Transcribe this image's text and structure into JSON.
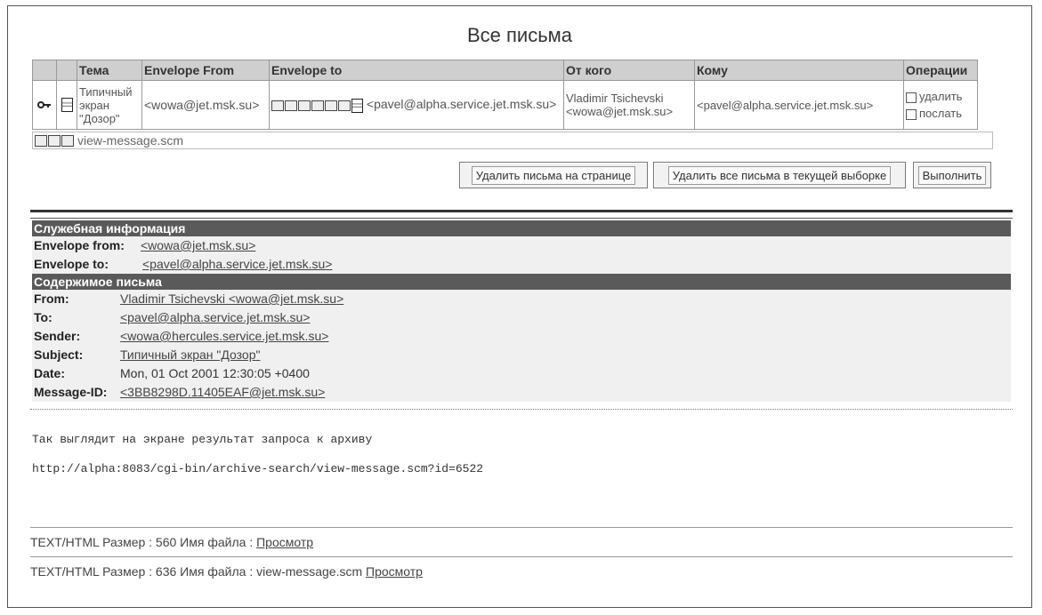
{
  "page": {
    "title": "Все письма"
  },
  "table": {
    "headers": [
      "Тема",
      "Envelope From",
      "Envelope to",
      "От кого",
      "Кому",
      "Операции"
    ],
    "row": {
      "subject_line1": "Типичный",
      "subject_line2": "экран",
      "subject_line3": "\"Дозор\"",
      "envelope_from": "<wowa@jet.msk.su>",
      "envelope_to": "<pavel@alpha.service.jet.msk.su>",
      "from_name": "Vladimir Tsichevski",
      "from_email": "<wowa@jet.msk.su>",
      "to": "<pavel@alpha.service.jet.msk.su>",
      "op_delete": "удалить",
      "op_send": "послать"
    }
  },
  "attachments_row": {
    "filename": "view-message.scm"
  },
  "buttons": {
    "delete_page": "Удалить письма на странице",
    "delete_all": "Удалить все письма в текущей выборке",
    "execute": "Выполнить"
  },
  "service_info": {
    "heading": "Служебная информация",
    "envelope_from_label": "Envelope from:",
    "envelope_from_value": "<wowa@jet.msk.su>",
    "envelope_to_label": "Envelope to:",
    "envelope_to_value": "<pavel@alpha.service.jet.msk.su>"
  },
  "content": {
    "heading": "Содержимое письма",
    "from_label": "From:",
    "from_value": "Vladimir Tsichevski <wowa@jet.msk.su>",
    "to_label": "To:",
    "to_value": "<pavel@alpha.service.jet.msk.su>",
    "sender_label": "Sender:",
    "sender_value": "<wowa@hercules.service.jet.msk.su>",
    "subject_label": "Subject:",
    "subject_value": "Типичный экран \"Дозор\"",
    "date_label": "Date:",
    "date_value": "Mon, 01 Oct 2001 12:30:05 +0400",
    "msgid_label": "Message-ID:",
    "msgid_value": "<3BB8298D.11405EAF@jet.msk.su>"
  },
  "body": {
    "line1": "Так выглядит на экране результат запроса к архиву",
    "line2": "http://alpha:8083/cgi-bin/archive-search/view-message.scm?id=6522"
  },
  "parts": [
    {
      "text": "TEXT/HTML Размер : 560 Имя файла : ",
      "link": "Просмотр"
    },
    {
      "text": "TEXT/HTML Размер : 636 Имя файла : view-message.scm ",
      "link": "Просмотр"
    }
  ]
}
